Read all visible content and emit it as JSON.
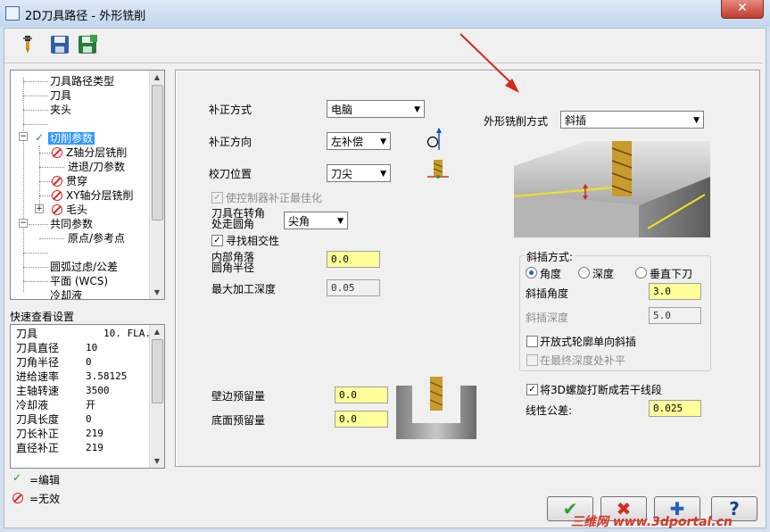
{
  "window": {
    "title": "2D刀具路径 - 外形铣削",
    "close": "✕"
  },
  "tree": {
    "items": [
      {
        "label": "刀具路径类型"
      },
      {
        "label": "刀具"
      },
      {
        "label": "夹头"
      },
      {
        "label": "切削参数"
      },
      {
        "label": "Z轴分层铣削"
      },
      {
        "label": "进退/刀参数"
      },
      {
        "label": "贯穿"
      },
      {
        "label": "XY轴分层铣削"
      },
      {
        "label": "毛头"
      },
      {
        "label": "共同参数"
      },
      {
        "label": "原点/参考点"
      },
      {
        "label": "圆弧过虑/公差"
      },
      {
        "label": "平面 (WCS)"
      },
      {
        "label": "冷却液"
      }
    ]
  },
  "quick_view": {
    "title": "快速查看设置",
    "rows": [
      {
        "label": "刀具",
        "value": "10. FLA..."
      },
      {
        "label": "刀具直径",
        "value": "10"
      },
      {
        "label": "刀角半径",
        "value": "0"
      },
      {
        "label": "进给速率",
        "value": "3.58125"
      },
      {
        "label": "主轴转速",
        "value": "3500"
      },
      {
        "label": "冷却液",
        "value": "开"
      },
      {
        "label": "刀具长度",
        "value": "0"
      },
      {
        "label": "刀长补正",
        "value": "219"
      },
      {
        "label": "直径补正",
        "value": "219"
      }
    ]
  },
  "legend": {
    "edit": "=编辑",
    "invalid": "=无效"
  },
  "form": {
    "comp_type_label": "补正方式",
    "comp_type_value": "电脑",
    "comp_dir_label": "补正方向",
    "comp_dir_value": "左补偿",
    "tip_label": "校刀位置",
    "tip_value": "刀尖",
    "optimize_label": "使控制器补正最佳化",
    "corner_label_1": "刀具在转角",
    "corner_label_2": "处走圆角",
    "corner_value": "尖角",
    "intersect_label": "寻找相交性",
    "inner_corner_label_1": "内部角落",
    "inner_corner_label_2": "圆角半径",
    "inner_corner_value": "0.0",
    "max_depth_label": "最大加工深度",
    "max_depth_value": "0.05",
    "wall_stock_label": "壁边预留量",
    "wall_stock_value": "0.0",
    "floor_stock_label": "底面预留量",
    "floor_stock_value": "0.0",
    "contour_type_label": "外形铣削方式",
    "contour_type_value": "斜插",
    "ramp_group_label": "斜插方式:",
    "ramp_angle_radio": "角度",
    "ramp_depth_radio": "深度",
    "ramp_vertical_radio": "垂直下刀",
    "ramp_angle_label": "斜插角度",
    "ramp_angle_value": "3.0",
    "ramp_depth_label": "斜插深度",
    "ramp_depth_value": "5.0",
    "open_contour_label": "开放式轮廓单向斜插",
    "final_depth_label": "在最终深度处补平",
    "helix_label": "将3D螺旋打断成若干线段",
    "linear_tol_label": "线性公差:",
    "linear_tol_value": "0.025"
  },
  "buttons": {
    "ok": "✔",
    "cancel": "✖",
    "add": "✚",
    "help": "?"
  },
  "watermark": "三维网 www.3dportal.cn",
  "colors": {
    "field_yellow": "#ffff99",
    "selection": "#3399ff",
    "ok_green": "#2e9b2e",
    "cancel_red": "#d42a1f",
    "arrow_red": "#d9261c"
  }
}
